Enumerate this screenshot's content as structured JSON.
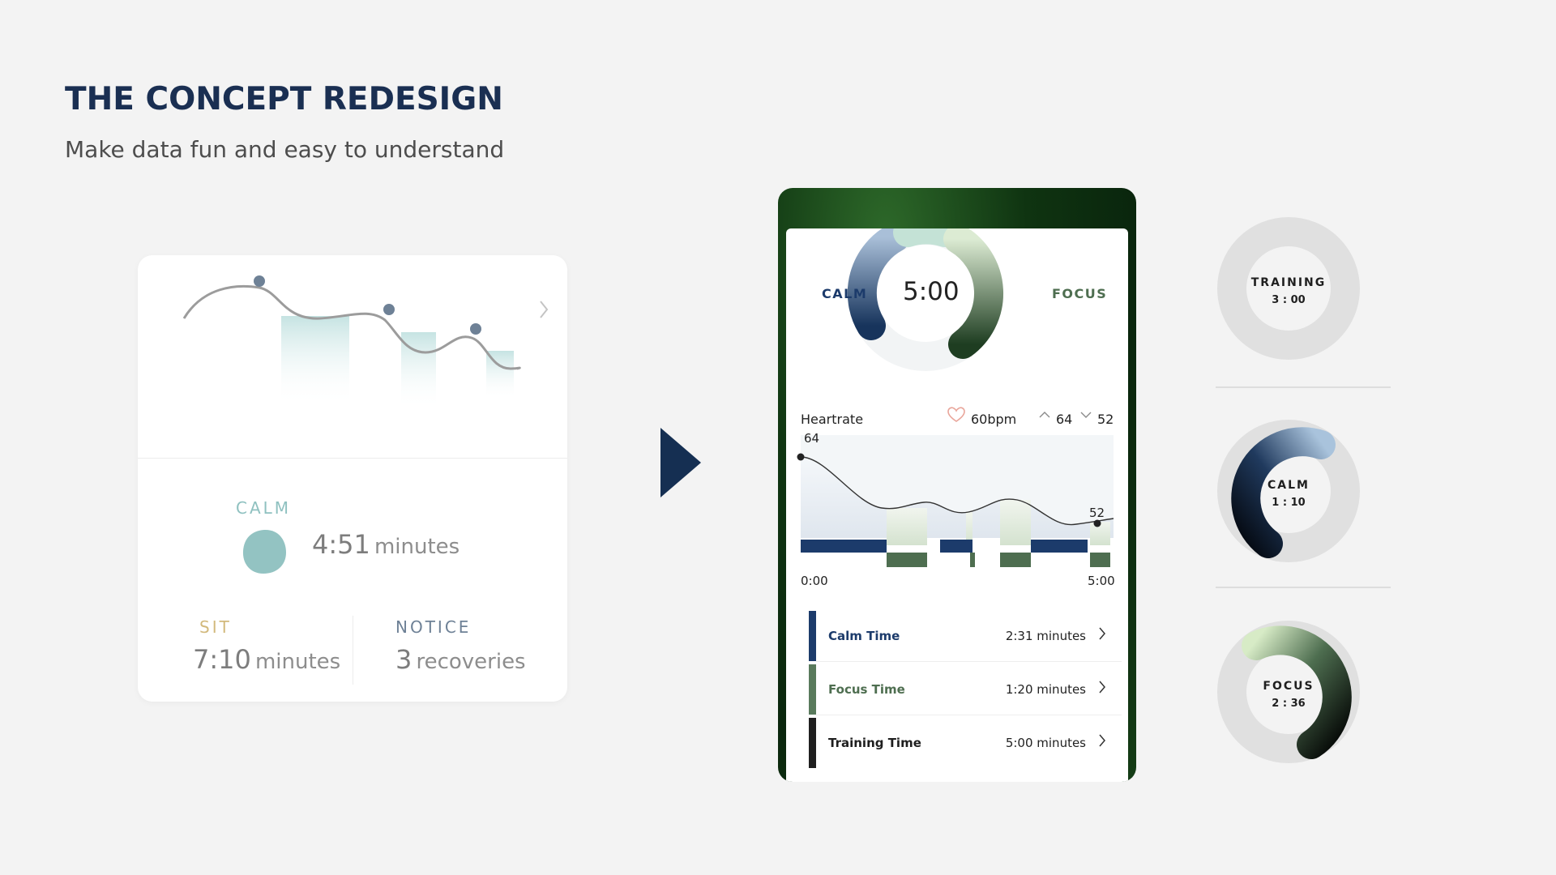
{
  "slide": {
    "title": "THE CONCEPT REDESIGN",
    "subtitle": "Make data fun and easy to understand"
  },
  "old_card": {
    "calm_label": "CALM",
    "calm_time": "4:51",
    "calm_unit": "minutes",
    "sit_label": "SIT",
    "sit_time": "7:10",
    "sit_unit": "minutes",
    "notice_label": "NOTICE",
    "notice_count": "3",
    "notice_unit": "recoveries"
  },
  "phone": {
    "timer": "5:00",
    "calm_label": "CALM",
    "focus_label": "FOCUS",
    "heartrate": {
      "label": "Heartrate",
      "avg": "60bpm",
      "max": "64",
      "min": "52",
      "start_value_label": "64",
      "end_value_label": "52",
      "time_start": "0:00",
      "time_end": "5:00"
    },
    "rows": [
      {
        "name": "Calm Time",
        "value": "2:31 minutes",
        "color": "#1c3b6b"
      },
      {
        "name": "Focus Time",
        "value": "1:20 minutes",
        "color": "#597a5c"
      },
      {
        "name": "Training Time",
        "value": "5:00 minutes",
        "color": "#1f1f1f"
      }
    ]
  },
  "rings": [
    {
      "label": "TRAINING",
      "time": "3 : 00"
    },
    {
      "label": "CALM",
      "time": "1 : 10"
    },
    {
      "label": "FOCUS",
      "time": "2 : 36"
    }
  ],
  "colors": {
    "title": "#1a2f52",
    "calm_teal": "#8fc1c0",
    "sit_gold": "#d2b97c",
    "notice_blue": "#6e8196",
    "calm_navy": "#1c3b6b",
    "focus_green": "#4e6e50",
    "ring_gray": "#e0e0e0"
  }
}
